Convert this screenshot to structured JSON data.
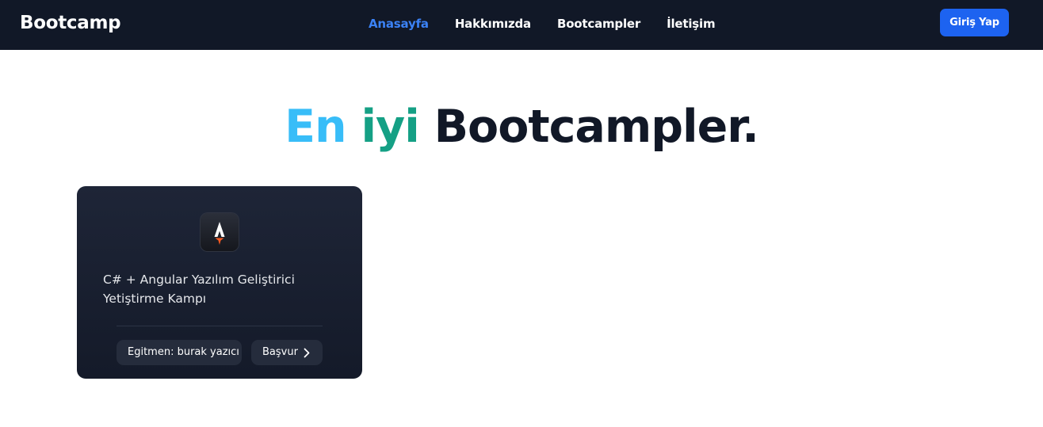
{
  "navbar": {
    "brand": "Bootcamp",
    "links": [
      {
        "label": "Anasayfa",
        "active": true
      },
      {
        "label": "Hakkımızda",
        "active": false
      },
      {
        "label": "Bootcampler",
        "active": false
      },
      {
        "label": "İletişim",
        "active": false
      }
    ],
    "login_label": "Giriş Yap"
  },
  "hero": {
    "word1": "En",
    "word2": "iyi",
    "word3": "Bootcampler."
  },
  "bootcamps": [
    {
      "logo_icon": "astro-logo-icon",
      "title": "C# + Angular Yazılım Geliştirici Yetiştirme Kampı",
      "instructor": "Egitmen: burak yazıcı",
      "apply_label": "Başvur",
      "apply_icon": "chevron-right-icon"
    }
  ],
  "colors": {
    "navbar_bg": "#111827",
    "active_link": "#3b82f6",
    "login_button": "#1d63f0",
    "hero_word1": "#38bdf8",
    "hero_word2": "#15a085",
    "hero_word3": "#111827",
    "card_bg": "#1a2030"
  }
}
